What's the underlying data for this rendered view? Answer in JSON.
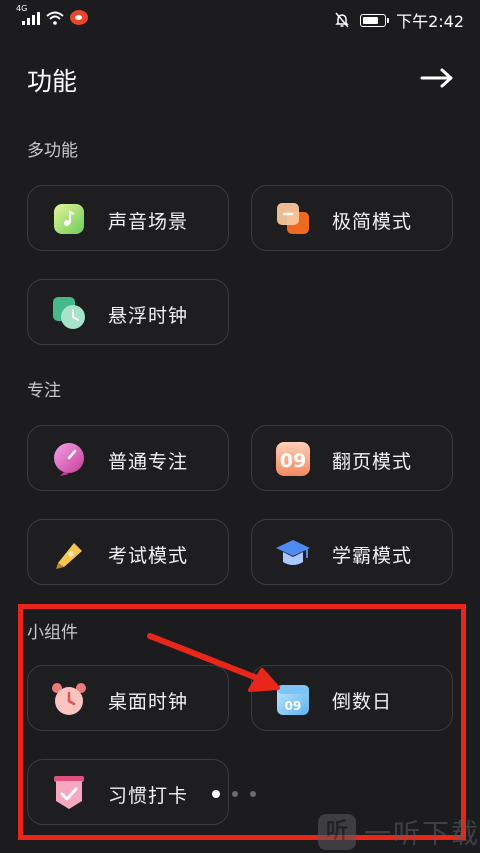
{
  "status_bar": {
    "network_label": "4G",
    "time": "下午2:42",
    "battery_level_pct": 80
  },
  "header": {
    "title": "功能"
  },
  "sections": [
    {
      "title": "多功能",
      "items": [
        {
          "label": "声音场景",
          "icon": "sound-scene-icon"
        },
        {
          "label": "极简模式",
          "icon": "minimal-mode-icon"
        },
        {
          "label": "悬浮时钟",
          "icon": "floating-clock-icon"
        }
      ]
    },
    {
      "title": "专注",
      "items": [
        {
          "label": "普通专注",
          "icon": "normal-focus-icon"
        },
        {
          "label": "翻页模式",
          "icon": "flip-page-icon",
          "icon_text": "09"
        },
        {
          "label": "考试模式",
          "icon": "exam-mode-pen-icon"
        },
        {
          "label": "学霸模式",
          "icon": "graduation-cap-icon"
        }
      ]
    },
    {
      "title": "小组件",
      "items": [
        {
          "label": "桌面时钟",
          "icon": "alarm-clock-icon"
        },
        {
          "label": "倒数日",
          "icon": "countdown-calendar-icon",
          "icon_text": "09"
        },
        {
          "label": "习惯打卡",
          "icon": "habit-checkin-icon"
        }
      ]
    }
  ],
  "pager": {
    "count": 3,
    "active_index": 0
  },
  "watermark": {
    "text": "一听下载",
    "badge_text": "听"
  },
  "colors": {
    "background": "#1c1c1e",
    "card_border": "#3b3b3f",
    "highlight_red": "#e8261a"
  }
}
